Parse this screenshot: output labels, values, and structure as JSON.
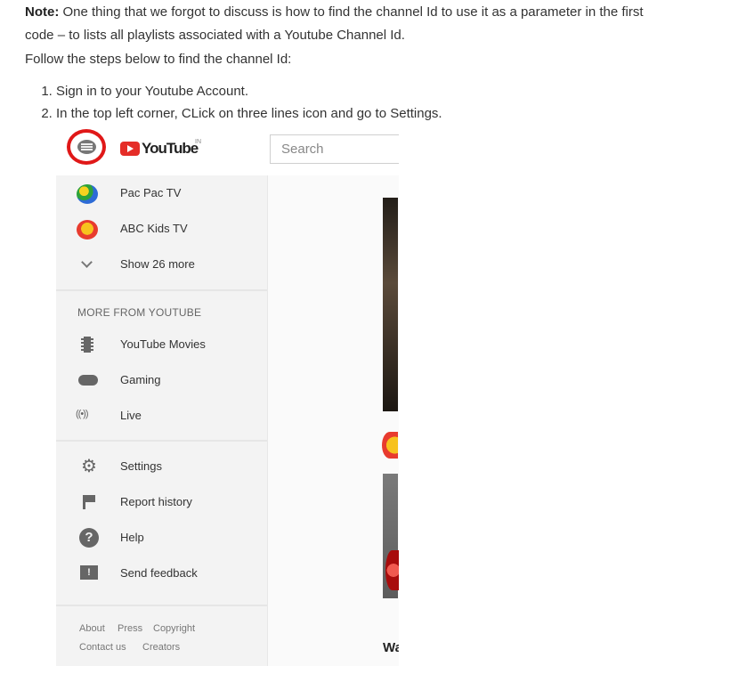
{
  "note": {
    "label": "Note:",
    "line1": " One thing that we forgot to discuss is how to find the channel Id to use it as a parameter in the first",
    "line2": "code – to lists all playlists associated with a Youtube Channel Id.",
    "line3": "Follow the steps below to find the channel Id:"
  },
  "steps": [
    "Sign in to your Youtube Account.",
    "In the top left corner, CLick on three lines icon and go to Settings."
  ],
  "screenshot": {
    "logo_text": "YouTube",
    "logo_sup": "IN",
    "search_placeholder": "Search",
    "subscriptions": [
      {
        "label": "Pac Pac TV",
        "icon": "channel-avatar"
      },
      {
        "label": "ABC Kids TV",
        "icon": "channel-avatar"
      },
      {
        "label": "Show 26 more",
        "icon": "chevron-down-icon"
      }
    ],
    "more_section_title": "MORE FROM YOUTUBE",
    "more_items": [
      {
        "label": "YouTube Movies",
        "icon": "film-icon"
      },
      {
        "label": "Gaming",
        "icon": "gamepad-icon"
      },
      {
        "label": "Live",
        "icon": "live-icon"
      }
    ],
    "live_icon_text": "((•))",
    "settings_items": [
      {
        "label": "Settings",
        "icon": "gear-icon"
      },
      {
        "label": "Report history",
        "icon": "flag-icon"
      },
      {
        "label": "Help",
        "icon": "help-icon"
      },
      {
        "label": "Send feedback",
        "icon": "feedback-icon"
      }
    ],
    "help_glyph": "?",
    "feedback_glyph": "!",
    "footer_links": [
      "About",
      "Press",
      "Copyright",
      "Contact us",
      "Creators"
    ],
    "content_text": "Wa",
    "colors": {
      "highlight_ring": "#e01818",
      "brand_red": "#e52d27"
    }
  }
}
